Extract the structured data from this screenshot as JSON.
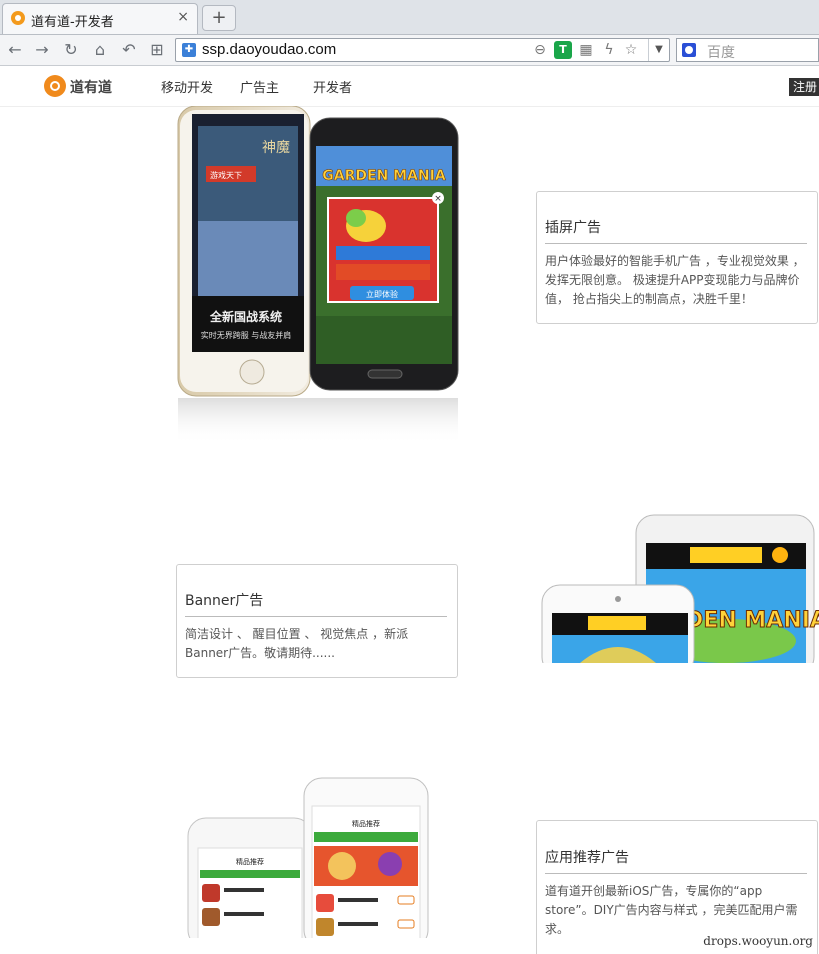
{
  "browser": {
    "tab_title": "道有道-开发者",
    "tab_close": "×",
    "new_tab": "+",
    "url": "ssp.daoyoudao.com",
    "search_placeholder": "百度"
  },
  "site": {
    "logo_text": "道有道",
    "nav": [
      "移动开发",
      "广告主",
      "开发者"
    ],
    "register": "注册"
  },
  "sections": [
    {
      "title": "插屏广告",
      "body": "用户体验最好的智能手机广告 ，专业视觉效果 ，发挥无限创意。 极速提升APP变现能力与品牌价值， 抢占指尖上的制高点，决胜千里！",
      "screen_texts": [
        "全新国战系统",
        "实时无界跨服 与战友并肩",
        "GARDEN MANIA",
        "立即体验"
      ]
    },
    {
      "title": "Banner广告",
      "body": "简洁设计 、 醒目位置 、 视觉焦点 ，新派Banner广告。敬请期待......",
      "screen_texts": [
        "GARDEN MANIA"
      ]
    },
    {
      "title": "应用推荐广告",
      "body": "道有道开创最新iOS广告，专属你的“app store”。DIY广告内容与样式 ，完美匹配用户需求。",
      "screen_texts": [
        "精品推荐",
        "精品推荐"
      ]
    }
  ],
  "watermark": "drops.wooyun.org"
}
